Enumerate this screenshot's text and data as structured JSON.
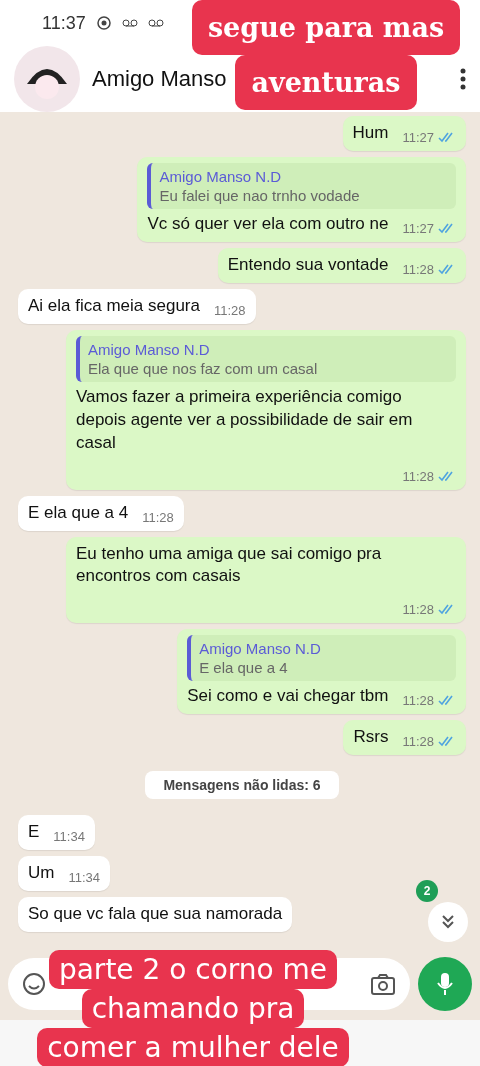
{
  "status_bar": {
    "time": "11:37"
  },
  "header": {
    "contact_name": "Amigo Manso"
  },
  "messages": [
    {
      "kind": "out",
      "text": "Hum",
      "time": "11:27",
      "read": true
    },
    {
      "kind": "out",
      "quote_author": "Amigo Manso N.D",
      "quote_text": "Eu falei que nao trnho vodade",
      "text": "Vc só quer ver ela com outro ne",
      "time": "11:27",
      "read": true
    },
    {
      "kind": "out",
      "text": "Entendo sua vontade",
      "time": "11:28",
      "read": true
    },
    {
      "kind": "in",
      "text": "Ai ela fica meia segura",
      "time": "11:28"
    },
    {
      "kind": "out",
      "quote_author": "Amigo Manso N.D",
      "quote_text": "Ela que  que nos faz com um casal",
      "text": "Vamos fazer a primeira experiência comigo depois agente ver a possibilidade de sair em casal",
      "time": "11:28",
      "read": true
    },
    {
      "kind": "in",
      "text": "E ela que a 4",
      "time": "11:28"
    },
    {
      "kind": "out",
      "text": "Eu tenho uma amiga que sai comigo pra encontros com casais",
      "time": "11:28",
      "read": true
    },
    {
      "kind": "out",
      "quote_author": "Amigo Manso N.D",
      "quote_text": "E ela que a 4",
      "text": "Sei como e vai chegar tbm",
      "time": "11:28",
      "read": true
    },
    {
      "kind": "out",
      "text": "Rsrs",
      "time": "11:28",
      "read": true
    },
    {
      "kind": "divider",
      "text": "Mensagens não lidas: 6"
    },
    {
      "kind": "in",
      "text": "E",
      "time": "11:34"
    },
    {
      "kind": "in",
      "text": "Um",
      "time": "11:34"
    },
    {
      "kind": "in",
      "text": "So que vc fala que sua namorada"
    }
  ],
  "unread_badge": "2",
  "captions": [
    {
      "kind": "top",
      "lines": [
        "segue para mas",
        "aventuras"
      ]
    },
    {
      "kind": "bottom",
      "lines": [
        "parte 2 o corno me",
        "chamando pra",
        "comer a mulher dele"
      ]
    }
  ]
}
